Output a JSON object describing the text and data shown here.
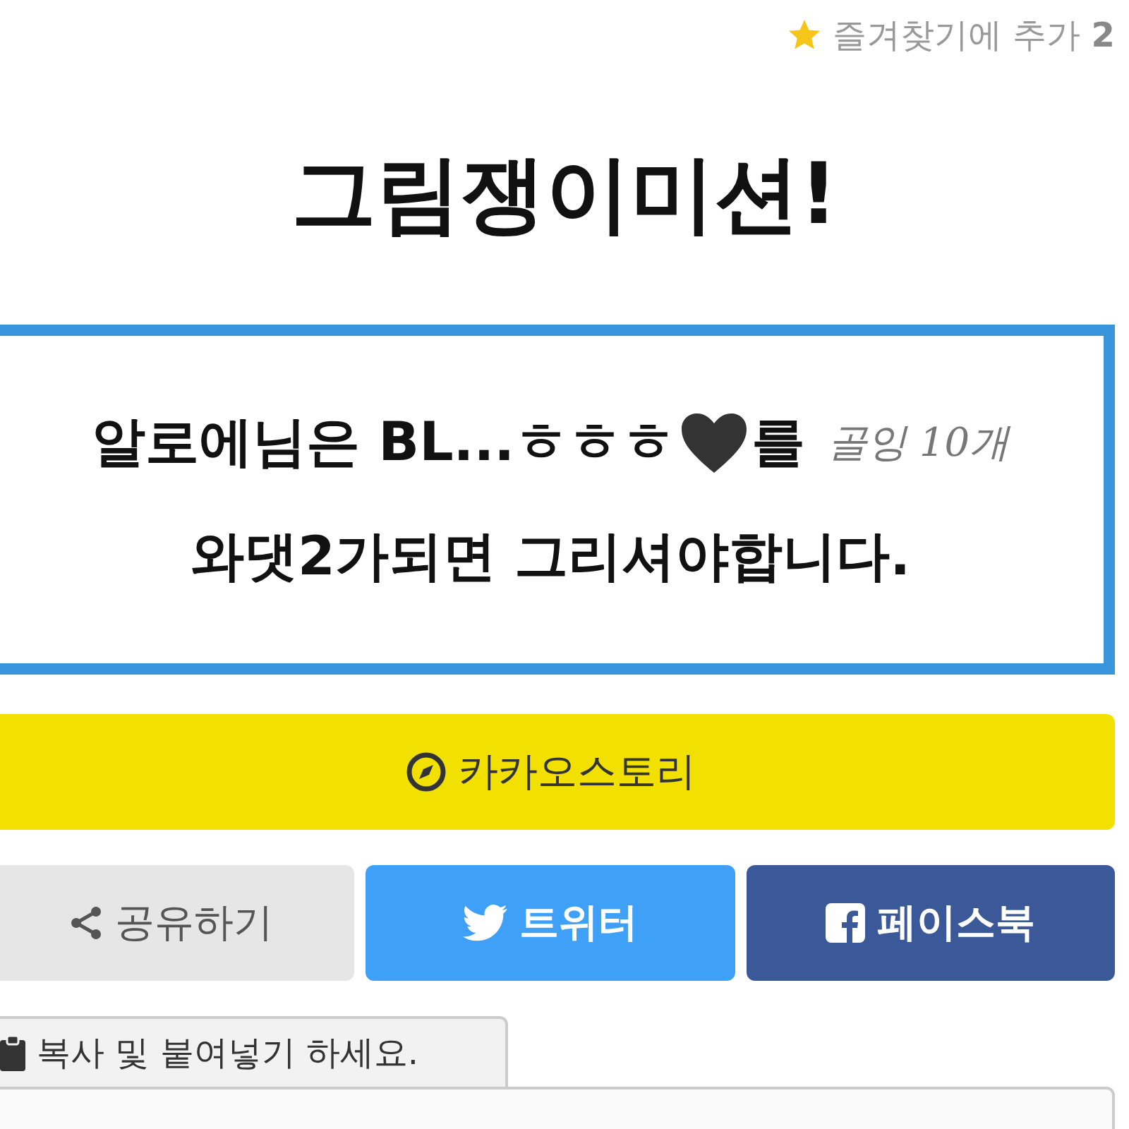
{
  "favorite": {
    "label": "즐겨찾기에 추가",
    "count": "2"
  },
  "title": "그림쟁이미션!",
  "mission": {
    "line_1": "알로에님은 BL...ㅎㅎㅎ",
    "line_1_end": "를",
    "handwritten_note": "골잉 10개",
    "line_2": "와댓2가되면 그리셔야합니다."
  },
  "share_buttons": [
    {
      "kind": "kakao",
      "label": "카카오스토리"
    },
    {
      "kind": "share",
      "label": "공유하기"
    },
    {
      "kind": "twitter",
      "label": "트위터"
    },
    {
      "kind": "facebook",
      "label": "페이스북"
    }
  ],
  "copy_tab": {
    "label": "복사 및 붙여넣기 하세요."
  }
}
